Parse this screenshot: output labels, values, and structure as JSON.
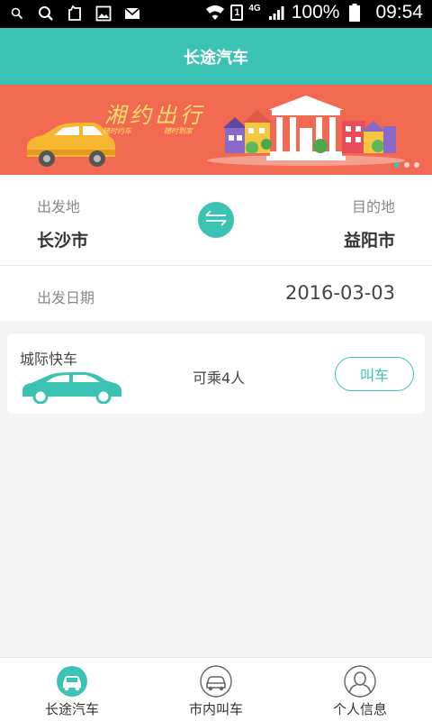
{
  "status_bar": {
    "icons_left": [
      "search-icon",
      "search-icon",
      "clipboard-icon",
      "image-icon",
      "mail-icon"
    ],
    "sim": "1",
    "network": "4G",
    "battery": "100%",
    "time": "09:54"
  },
  "header": {
    "title": "长途汽车"
  },
  "banner": {
    "title": "湘约出行",
    "subtitle_left": "随时约车",
    "subtitle_right": "随时到家",
    "page_count": 3,
    "active_index": 0
  },
  "route": {
    "from_label": "出发地",
    "from_city": "长沙市",
    "to_label": "目的地",
    "to_city": "益阳市",
    "date_label": "出发日期",
    "date_value": "2016-03-03"
  },
  "service": {
    "name": "城际快车",
    "seats": "可乘4人",
    "call_label": "叫车"
  },
  "nav": {
    "items": [
      {
        "label": "长途汽车",
        "icon": "bus-car-icon",
        "active": true
      },
      {
        "label": "市内叫车",
        "icon": "taxi-car-icon",
        "active": false
      },
      {
        "label": "个人信息",
        "icon": "person-icon",
        "active": false
      }
    ]
  },
  "colors": {
    "accent": "#3cc2b3",
    "banner_bg": "#f26952",
    "banner_text": "#ffe06a"
  }
}
